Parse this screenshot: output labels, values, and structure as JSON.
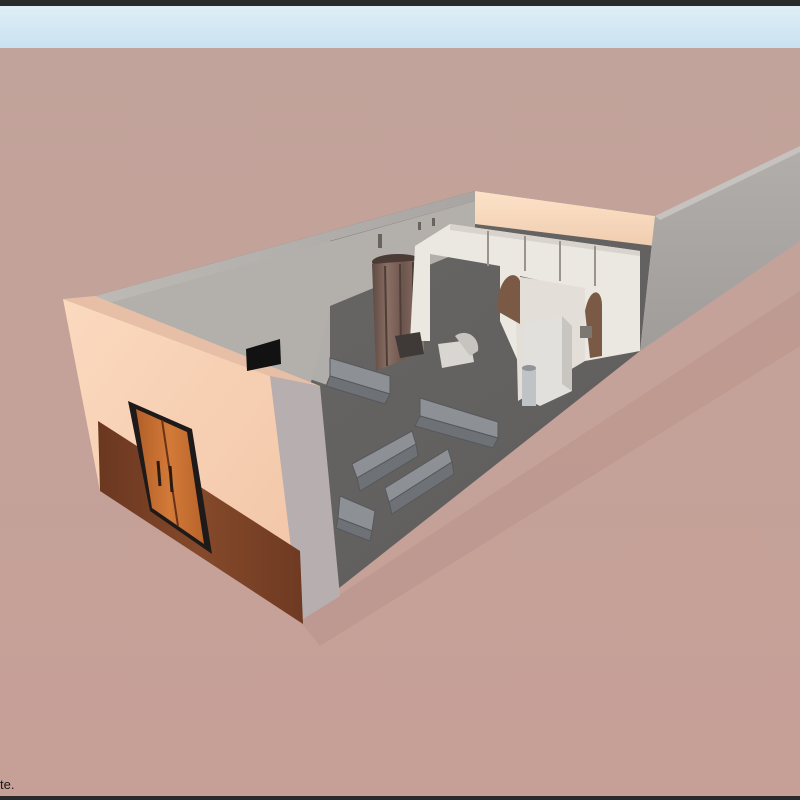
{
  "viewer": {
    "status_text": "te."
  },
  "colors": {
    "sky_top": "#cfe6f2",
    "ground": "#c7a199",
    "front_wall": "#f6cdb0",
    "wood": "#7b4226",
    "door": "#c8702f",
    "back_wall": "#b9b6b2",
    "floor": "#6f6d6a",
    "side_wall": "#a9a5a2",
    "partition": "#e8e4de",
    "seat": "#8a8c90"
  },
  "objects": [
    {
      "name": "entrance-door"
    },
    {
      "name": "wall-monitor"
    },
    {
      "name": "curtain-booth"
    },
    {
      "name": "exam-booths"
    },
    {
      "name": "water-dispenser"
    },
    {
      "name": "lounge-chairs"
    },
    {
      "name": "waiting-seat-rows"
    }
  ]
}
